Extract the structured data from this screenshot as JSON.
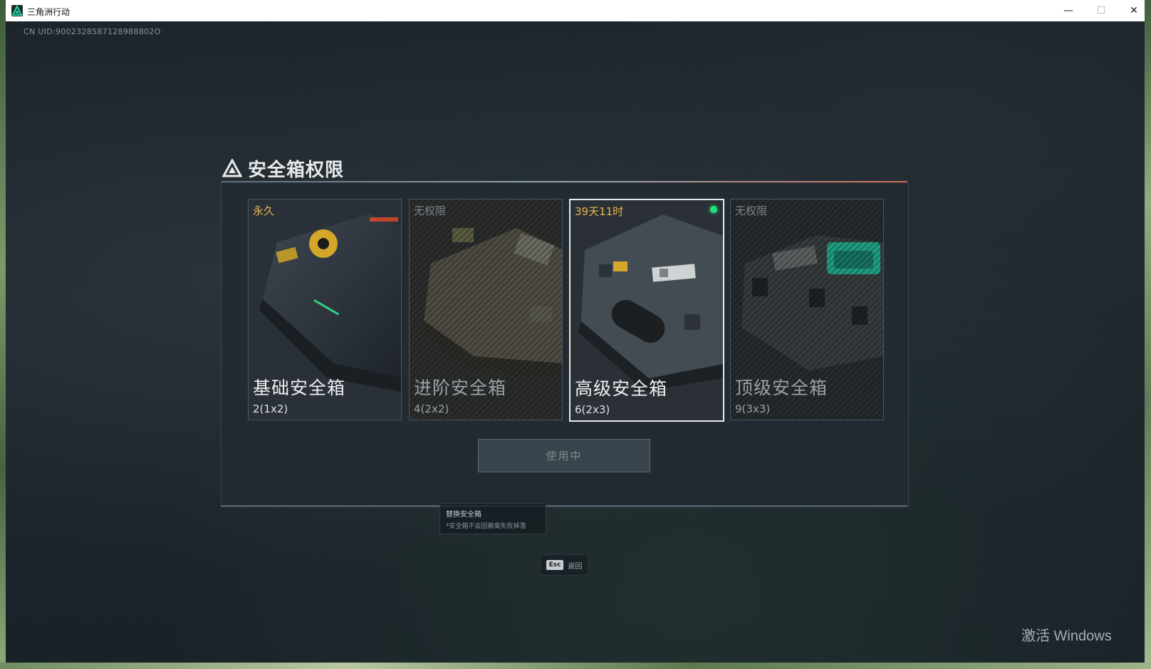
{
  "window": {
    "title": "三角洲行动",
    "controls": {
      "minimize": "—",
      "maximize": "☐",
      "close": "✕"
    }
  },
  "uid": "CN UID:9002328587128988802O",
  "panel": {
    "title": "安全箱权限",
    "cards": [
      {
        "status": "永久",
        "name": "基础安全箱",
        "capacity": "2(1x2)",
        "locked": false,
        "selected": false
      },
      {
        "status": "无权限",
        "name": "进阶安全箱",
        "capacity": "4(2x2)",
        "locked": true,
        "selected": false
      },
      {
        "status": "39天11时",
        "name": "高级安全箱",
        "capacity": "6(2x3)",
        "locked": false,
        "selected": true
      },
      {
        "status": "无权限",
        "name": "顶级安全箱",
        "capacity": "9(3x3)",
        "locked": true,
        "selected": false
      }
    ],
    "use_button": "使用中"
  },
  "tip": {
    "title": "替换安全箱",
    "note": "*安全箱不会因撤离失败掉落"
  },
  "esc": {
    "key": "Esc",
    "label": "返回"
  },
  "watermark": "激活 Windows",
  "colors": {
    "gold": "#e7b94e",
    "active_dot": "#26e07a",
    "teal_accent": "#1f9c7f"
  }
}
